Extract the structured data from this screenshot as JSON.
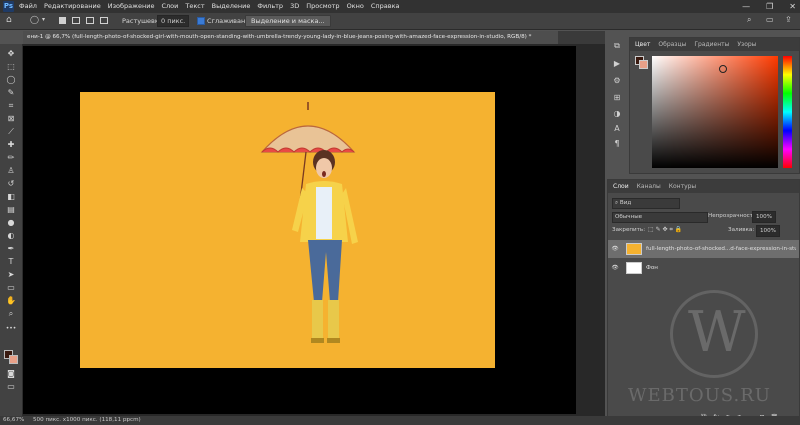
{
  "menubar": {
    "logo": "Ps",
    "items": [
      "Файл",
      "Редактирование",
      "Изображение",
      "Слои",
      "Текст",
      "Выделение",
      "Фильтр",
      "3D",
      "Просмотр",
      "Окно",
      "Справка"
    ],
    "window_controls": [
      "—",
      "❐",
      "✕"
    ]
  },
  "options": {
    "feather_label": "Растушевка:",
    "feather_value": "0 пикс.",
    "antialias_label": "Сглаживание",
    "mask_button": "Выделение и маска..."
  },
  "document_tab": {
    "title": "ени-1 @ 66,7% (full-length-photo-of-shocked-girl-with-mouth-open-standing-with-umbrella-trendy-young-lady-in-blue-jeans-posing-with-amazed-face-expression-in-studio, RGB/8) *"
  },
  "status": {
    "zoom": "66,67%",
    "size": "500 пикс. x1000 пикс. (118,11 ppcm)",
    "arrow": "›"
  },
  "color_panel": {
    "tabs": [
      "Цвет",
      "Образцы",
      "Градиенты",
      "Узоры"
    ],
    "active_tab": "Цвет",
    "hue_color": "#ff3a00"
  },
  "layers_panel": {
    "tabs": [
      "Слои",
      "Каналы",
      "Контуры"
    ],
    "active_tab": "Слои",
    "filter_label": "Вид",
    "blend_mode": "Обычные",
    "opacity_label": "Непрозрачность:",
    "opacity_value": "100%",
    "lock_label": "Закрепить:",
    "fill_label": "Заливка:",
    "fill_value": "100%",
    "layers": [
      {
        "name": "full-length-photo-of-shocked...d-face-expression-in-studio",
        "selected": true
      },
      {
        "name": "Фон",
        "selected": false
      }
    ],
    "bottom_icons": [
      "⛓",
      "fx",
      "◐",
      "◑",
      "▭",
      "⊞",
      "🗑"
    ]
  },
  "watermark": {
    "letter": "W",
    "text": "WEBTOUS.RU"
  },
  "colors": {
    "background": "#f5b230",
    "foreground_swatch": "#3a1a10",
    "background_swatch": "#e8a088"
  }
}
